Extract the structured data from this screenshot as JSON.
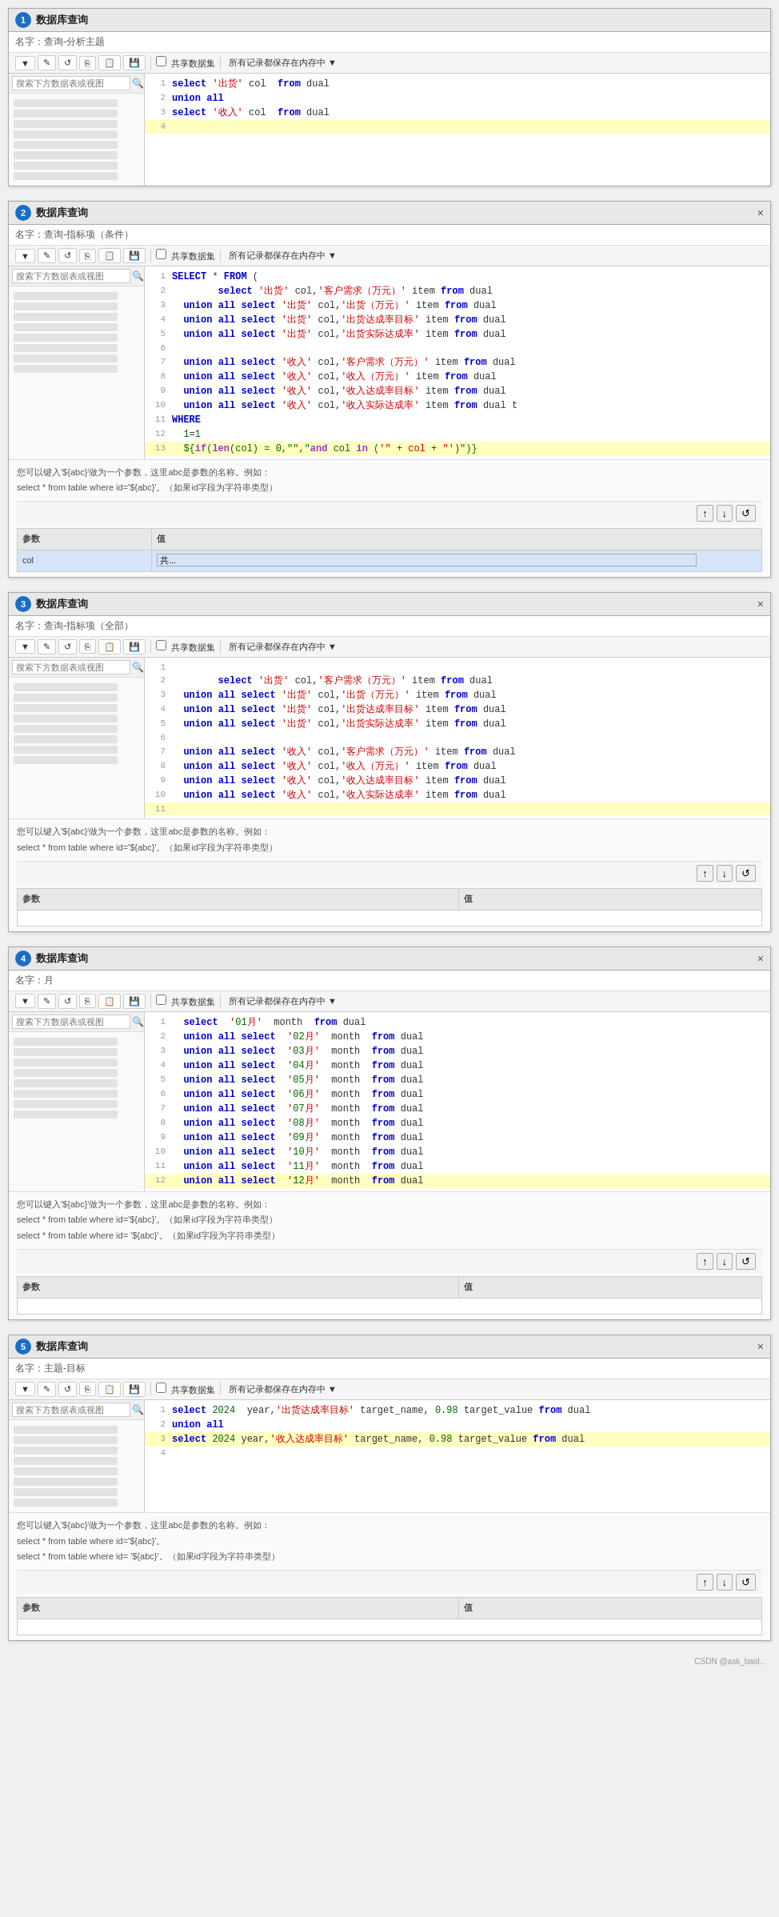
{
  "panels": [
    {
      "id": "panel1",
      "num": "1",
      "title": "数据库查询",
      "name_label": "名字：",
      "name_value": "查询-分析主题",
      "has_close": false,
      "toolbar": {
        "select_option": "共享数据集",
        "label": "所有记录都保存在内存中"
      },
      "code_lines": [
        {
          "num": 1,
          "content": "select '出货' col  from dual",
          "hl": false
        },
        {
          "num": 2,
          "content": "union all",
          "hl": false
        },
        {
          "num": 3,
          "content": "select '收入' col  from dual",
          "hl": false
        },
        {
          "num": 4,
          "content": "",
          "hl": true
        }
      ],
      "show_info": false,
      "show_params": false
    },
    {
      "id": "panel2",
      "num": "2",
      "title": "数据库查询",
      "name_label": "名字：",
      "name_value": "查询-指标项（条件）",
      "has_close": true,
      "toolbar": {
        "select_option": "共享数据集",
        "label": "所有记录都保存在内存中"
      },
      "code_lines": [
        {
          "num": 1,
          "content": "SELECT * FROM (",
          "hl": false
        },
        {
          "num": 2,
          "content": "        select '出货' col,'客户需求（万元）' item from dual",
          "hl": false
        },
        {
          "num": 3,
          "content": "  union all select '出货' col,'出货（万元）' item from dual",
          "hl": false
        },
        {
          "num": 4,
          "content": "  union all select '出货' col,'出货达成率目标' item from dual",
          "hl": false
        },
        {
          "num": 5,
          "content": "  union all select '出货' col,'出货实际达成率' item from dual",
          "hl": false
        },
        {
          "num": 6,
          "content": "",
          "hl": false
        },
        {
          "num": 7,
          "content": "  union all select '收入' col,'客户需求（万元）' item from dual",
          "hl": false
        },
        {
          "num": 8,
          "content": "  union all select '收入' col,'收入（万元）' item from dual",
          "hl": false
        },
        {
          "num": 9,
          "content": "  union all select '收入' col,'收入达成率目标' item from dual",
          "hl": false
        },
        {
          "num": 10,
          "content": "  union all select '收入' col,'收入实际达成率' item from dual t",
          "hl": false
        },
        {
          "num": 11,
          "content": "WHERE",
          "hl": false
        },
        {
          "num": 12,
          "content": "  1=1",
          "hl": false
        },
        {
          "num": 13,
          "content": "  ${if(len(col) = 0,\"\",\"and col in ('\" + col + \"')\")}",
          "hl": true
        }
      ],
      "show_info": true,
      "info_text": "您可以键入'${abc}'做为一个参数，这里abc是参数的名称。例如：\nselect * from table where id='${abc}'。（如果id字段为字符串类型）",
      "show_params": true,
      "params": [
        {
          "name": "col",
          "value": "共..."
        }
      ]
    },
    {
      "id": "panel3",
      "num": "3",
      "title": "数据库查询",
      "name_label": "名字：",
      "name_value": "查询-指标项（全部）",
      "has_close": true,
      "toolbar": {
        "select_option": "共享数据集",
        "label": "所有记录都保存在内存中"
      },
      "code_lines": [
        {
          "num": 1,
          "content": "",
          "hl": false
        },
        {
          "num": 2,
          "content": "        select '出货' col,'客户需求（万元）' item from dual",
          "hl": false
        },
        {
          "num": 3,
          "content": "  union all select '出货' col,'出货（万元）' item from dual",
          "hl": false
        },
        {
          "num": 4,
          "content": "  union all select '出货' col,'出货达成率目标' item from dual",
          "hl": false
        },
        {
          "num": 5,
          "content": "  union all select '出货' col,'出货实际达成率' item from dual",
          "hl": false
        },
        {
          "num": 6,
          "content": "",
          "hl": false
        },
        {
          "num": 7,
          "content": "  union all select '收入' col,'客户需求（万元）' item from dual",
          "hl": false
        },
        {
          "num": 8,
          "content": "  union all select '收入' col,'收入（万元）' item from dual",
          "hl": false
        },
        {
          "num": 9,
          "content": "  union all select '收入' col,'收入达成率目标' item from dual",
          "hl": false
        },
        {
          "num": 10,
          "content": "  union all select '收入' col,'收入实际达成率' item from dual",
          "hl": false
        },
        {
          "num": 11,
          "content": "",
          "hl": true
        }
      ],
      "show_info": true,
      "info_text": "您可以键入'${abc}'做为一个参数，这里abc是参数的名称。例如：\nselect * from table where id='${abc}'。（如果id字段为字符串类型）",
      "show_params": true,
      "params": []
    },
    {
      "id": "panel4",
      "num": "4",
      "title": "数据库查询",
      "name_label": "名字：",
      "name_value": "月",
      "has_close": true,
      "toolbar": {
        "select_option": "共享数据集",
        "label": "所有记录都保存在内存中"
      },
      "code_lines": [
        {
          "num": 1,
          "content": "  select  '01月'  month  from dual",
          "hl": false
        },
        {
          "num": 2,
          "content": "  union all select  '02月'  month  from dual",
          "hl": false
        },
        {
          "num": 3,
          "content": "  union all select  '03月'  month  from dual",
          "hl": false
        },
        {
          "num": 4,
          "content": "  union all select  '04月'  month  from dual",
          "hl": false
        },
        {
          "num": 5,
          "content": "  union all select  '05月'  month  from dual",
          "hl": false
        },
        {
          "num": 6,
          "content": "  union all select  '06月'  month  from dual",
          "hl": false
        },
        {
          "num": 7,
          "content": "  union all select  '07月'  month  from dual",
          "hl": false
        },
        {
          "num": 8,
          "content": "  union all select  '08月'  month  from dual",
          "hl": false
        },
        {
          "num": 9,
          "content": "  union all select  '09月'  month  from dual",
          "hl": false
        },
        {
          "num": 10,
          "content": "  union all select  '10月'  month  from dual",
          "hl": false
        },
        {
          "num": 11,
          "content": "  union all select  '11月'  month  from dual",
          "hl": false
        },
        {
          "num": 12,
          "content": "  union all select  '12月'  month  from dual",
          "hl": true
        }
      ],
      "show_info": true,
      "info_text": "您可以键入'${abc}'做为一个参数，这里abc是参数的名称。例如：\nselect * from table where id='${abc}'。（如果id字段为字符串类型）\nselect * from table where id= '${abc}'。（如果id字段为字符串类型）",
      "show_params": true,
      "params": []
    },
    {
      "id": "panel5",
      "num": "5",
      "title": "数据库查询",
      "name_label": "名字：",
      "name_value": "主题-目标",
      "has_close": true,
      "toolbar": {
        "select_option": "共享数据集",
        "label": "所有记录都保存在内存中"
      },
      "code_lines": [
        {
          "num": 1,
          "content": "select 2024  year,'出货达成率目标' target_name, 0.98 target_value from dual",
          "hl": false
        },
        {
          "num": 2,
          "content": "union all",
          "hl": false
        },
        {
          "num": 3,
          "content": "select 2024 year,'收入达成率目标' target_name, 0.98 target_value from dual",
          "hl": true
        },
        {
          "num": 4,
          "content": "",
          "hl": false
        }
      ],
      "show_info": true,
      "info_text": "您可以键入'${abc}'做为一个参数，这里abc是参数的名称。例如：\nselect * from table where id='${abc}'。\nselect * from table where id= '${abc}'。（如果id字段为字符串类型）",
      "show_params": true,
      "params": []
    }
  ],
  "watermark": "CSDN @ask_baid...",
  "ui": {
    "search_placeholder": "搜索下方数据表或视图",
    "toolbar_icons": [
      "▼",
      "✎",
      "↺",
      "⎘",
      "📋",
      "💾",
      "☁"
    ],
    "toolbar_shared": "□ 共享数据集",
    "toolbar_memory": "所有记录都保存在内存中 ▼",
    "params_col_name": "参数",
    "params_col_value": "值",
    "nav_up": "↑",
    "nav_down": "↓",
    "nav_refresh": "↺"
  }
}
